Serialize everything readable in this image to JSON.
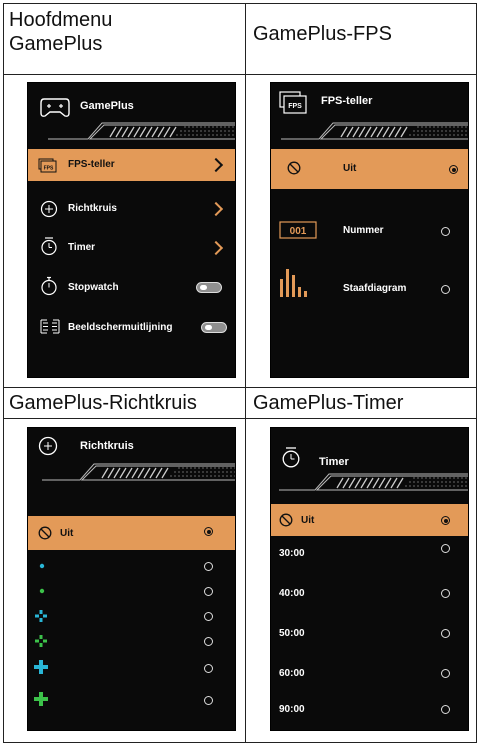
{
  "cells": {
    "main_menu": {
      "title_line1": "Hoofdmenu",
      "title_line2": "GamePlus"
    },
    "fps": {
      "title": "GamePlus-FPS"
    },
    "crosshair": {
      "title": "GamePlus-Richtkruis"
    },
    "timer": {
      "title": "GamePlus-Timer"
    }
  },
  "main_menu_screen": {
    "header": "GamePlus",
    "items": [
      {
        "label": "FPS-teller",
        "control": "chevron",
        "selected": true
      },
      {
        "label": "Richtkruis",
        "control": "chevron"
      },
      {
        "label": "Timer",
        "control": "chevron"
      },
      {
        "label": "Stopwatch",
        "control": "toggle"
      },
      {
        "label": "Beeldschermuitlijning",
        "control": "toggle"
      }
    ]
  },
  "fps_screen": {
    "header": "FPS-teller",
    "fps_badge_text": "FPS",
    "options": [
      {
        "label": "Uit",
        "selected": true
      },
      {
        "label": "Nummer",
        "badge": "001"
      },
      {
        "label": "Staafdiagram"
      }
    ]
  },
  "crosshair_screen": {
    "header": "Richtkruis",
    "options": [
      {
        "label": "Uit",
        "selected": true
      },
      {
        "style": "small-dot-cyan"
      },
      {
        "style": "small-dot-green"
      },
      {
        "style": "cross-small-cyan"
      },
      {
        "style": "cross-small-green"
      },
      {
        "style": "cross-large-cyan"
      },
      {
        "style": "cross-large-green"
      }
    ]
  },
  "timer_screen": {
    "header": "Timer",
    "options": [
      {
        "label": "Uit",
        "selected": true
      },
      {
        "label": "30:00"
      },
      {
        "label": "40:00"
      },
      {
        "label": "50:00"
      },
      {
        "label": "60:00"
      },
      {
        "label": "90:00"
      }
    ]
  },
  "colors": {
    "accent": "#e39a58",
    "screen_bg": "#0a0a0a",
    "cyan": "#29b6d6",
    "green": "#3cc24a"
  }
}
